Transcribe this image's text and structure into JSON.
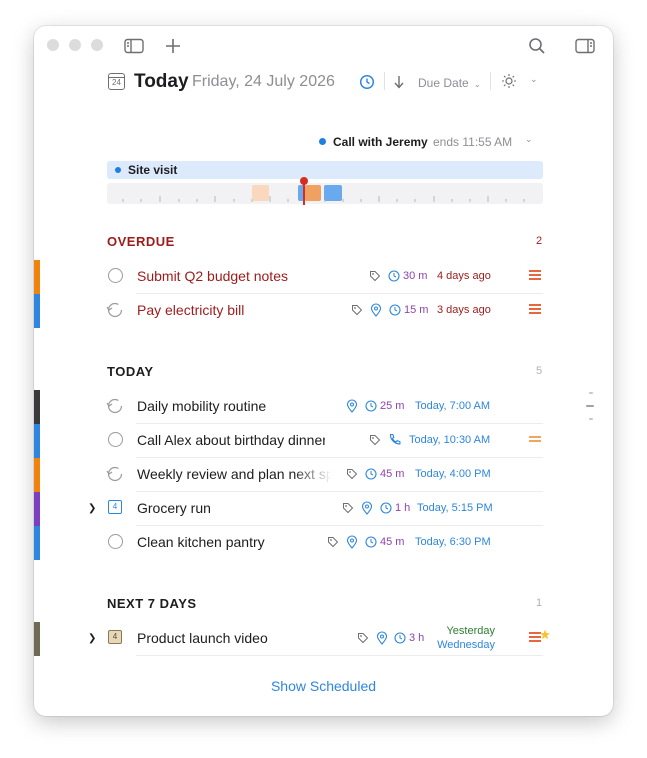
{
  "header": {
    "calendar_day": "24",
    "title": "Today",
    "date": "Friday, 24 July 2026",
    "sort_label": "Due Date"
  },
  "timeline": {
    "current_event": "Call with Jeremy",
    "current_event_ends": "ends 11:55 AM",
    "all_day_event": "Site visit"
  },
  "sections": {
    "overdue": {
      "title": "OVERDUE",
      "count": "2",
      "tasks": [
        {
          "title": "Submit Q2 budget notes",
          "duration": "30 m",
          "due": "4 days ago"
        },
        {
          "title": "Pay electricity bill",
          "duration": "15 m",
          "due": "3 days ago"
        }
      ]
    },
    "today": {
      "title": "TODAY",
      "count": "5",
      "tasks": [
        {
          "title": "Daily mobility routine",
          "duration": "25 m",
          "due": "Today, 7:00 AM"
        },
        {
          "title": "Call Alex about birthday dinner",
          "duration": "",
          "due": "Today, 10:30 AM"
        },
        {
          "title": "Weekly review and plan next sprint",
          "duration": "45 m",
          "due": "Today, 4:00 PM"
        },
        {
          "title": "Grocery run",
          "duration": "1 h",
          "due": "Today, 5:15 PM",
          "checklist_count": "4"
        },
        {
          "title": "Clean kitchen pantry",
          "duration": "45 m",
          "due": "Today, 6:30 PM"
        }
      ]
    },
    "next7": {
      "title": "NEXT 7 DAYS",
      "count": "1",
      "tasks": [
        {
          "title": "Product launch video",
          "duration": "3 h",
          "due_line1": "Yesterday",
          "due_line2": "Wednesday",
          "checklist_count": "4"
        }
      ]
    }
  },
  "footer": {
    "show_scheduled": "Show Scheduled"
  },
  "colors": {
    "overdue_red": "#9e1b1b",
    "accent_blue": "#2e86de",
    "duration_purple": "#8e44ad",
    "due_green": "#2e7d32",
    "priority_orange": "#f0803c"
  }
}
